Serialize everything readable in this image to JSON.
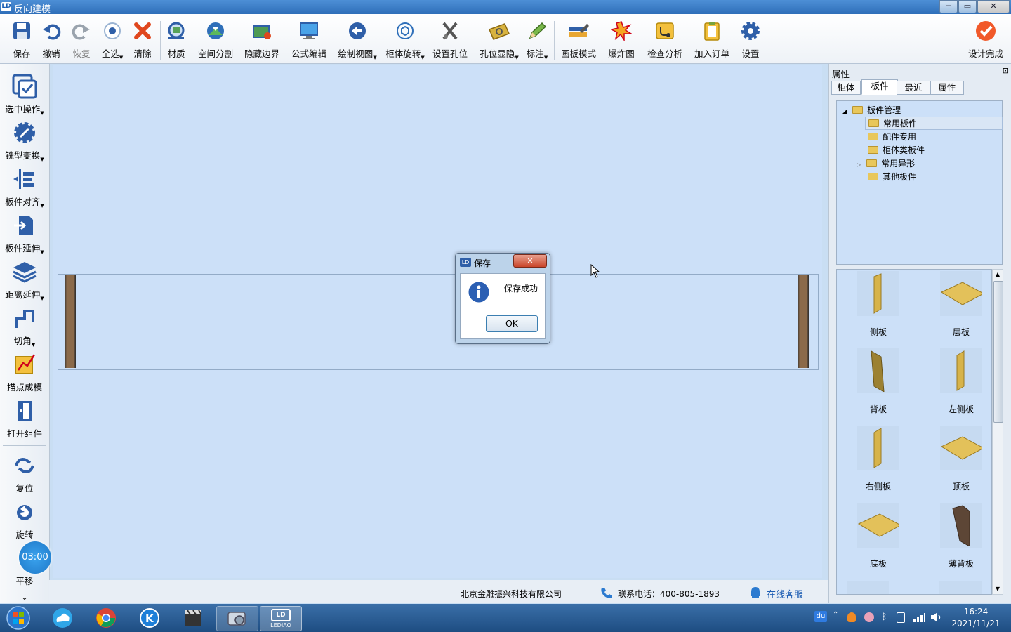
{
  "window": {
    "title": "反向建模",
    "controls": [
      "─",
      "▭",
      "✕"
    ]
  },
  "toolbar": {
    "items": [
      {
        "label": "保存",
        "icon": "save-icon"
      },
      {
        "label": "撤销",
        "icon": "undo-icon"
      },
      {
        "label": "恢复",
        "icon": "redo-icon"
      },
      {
        "label": "全选",
        "icon": "select-all-icon"
      },
      {
        "label": "清除",
        "icon": "clear-icon"
      },
      {
        "label": "材质",
        "icon": "material-icon"
      },
      {
        "label": "空间分割",
        "icon": "space-split-icon"
      },
      {
        "label": "隐藏边界",
        "icon": "hide-border-icon"
      },
      {
        "label": "公式编辑",
        "icon": "formula-edit-icon"
      },
      {
        "label": "绘制视图",
        "icon": "draw-view-icon"
      },
      {
        "label": "柜体旋转",
        "icon": "cabinet-rotate-icon"
      },
      {
        "label": "设置孔位",
        "icon": "set-holes-icon"
      },
      {
        "label": "孔位显隐",
        "icon": "hole-visibility-icon"
      },
      {
        "label": "标注",
        "icon": "annotate-icon"
      },
      {
        "label": "画板模式",
        "icon": "drawing-board-icon"
      },
      {
        "label": "爆炸图",
        "icon": "explode-view-icon"
      },
      {
        "label": "检查分析",
        "icon": "check-analysis-icon"
      },
      {
        "label": "加入订单",
        "icon": "add-order-icon"
      },
      {
        "label": "设置",
        "icon": "settings-gear-icon"
      },
      {
        "label": "设计完成",
        "icon": "design-complete-icon"
      }
    ]
  },
  "leftbar": {
    "items": [
      {
        "label": "选中操作",
        "icon": "select-operation-icon"
      },
      {
        "label": "铣型变换",
        "icon": "milling-transform-icon"
      },
      {
        "label": "板件对齐",
        "icon": "panel-align-icon"
      },
      {
        "label": "板件延伸",
        "icon": "panel-extend-icon"
      },
      {
        "label": "距离延伸",
        "icon": "distance-extend-icon"
      },
      {
        "label": "切角",
        "icon": "chamfer-icon"
      },
      {
        "label": "描点成模",
        "icon": "points-to-model-icon"
      },
      {
        "label": "打开组件",
        "icon": "open-component-icon"
      },
      {
        "label": "复位",
        "icon": "reset-icon"
      },
      {
        "label": "旋转",
        "icon": "rotate-icon"
      },
      {
        "label": "平移",
        "icon": "pan-icon"
      }
    ],
    "timer": "03:00",
    "more": "⌄"
  },
  "dialog": {
    "title": "保存",
    "message": "保存成功",
    "ok_label": "OK",
    "close_label": "✕"
  },
  "statusbar": {
    "company": "北京金雕振兴科技有限公司",
    "phone": "联系电话：400-805-1893",
    "support": "在线客服"
  },
  "panel": {
    "title": "属性",
    "pin": "⊡",
    "tabs": [
      "柜体",
      "板件",
      "最近",
      "属性"
    ],
    "active_tab": 1,
    "tree": {
      "root": "板件管理",
      "children": [
        "常用板件",
        "配件专用",
        "柜体类板件",
        "常用异形",
        "其他板件"
      ]
    },
    "gallery": [
      "侧板",
      "层板",
      "背板",
      "左侧板",
      "右侧板",
      "顶板",
      "底板",
      "薄背板"
    ]
  },
  "taskbar": {
    "time": "16:24",
    "date": "2021/11/21",
    "app_label": "LEDIAO",
    "tray_ime": "du"
  },
  "colors": {
    "canvas": "#cce0f8",
    "panel_wood": "#8b6a4a",
    "accent": "#2f6fb9"
  }
}
